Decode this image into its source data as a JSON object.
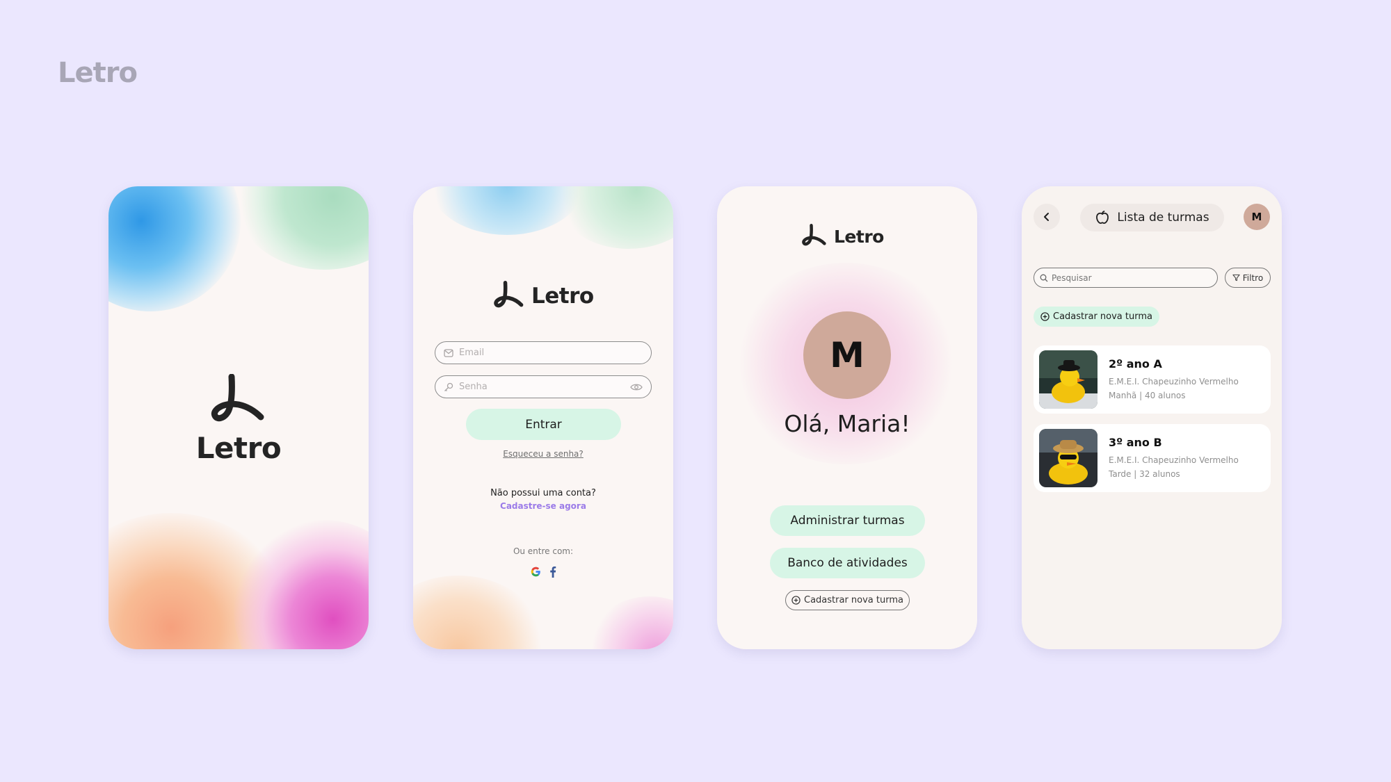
{
  "brand": "Letro",
  "logo_word": "Letro",
  "login": {
    "email_placeholder": "Email",
    "password_placeholder": "Senha",
    "enter_button": "Entrar",
    "forgot_password": "Esqueceu a senha?",
    "no_account": "Não possui uma conta?",
    "signup_link": "Cadastre-se agora",
    "or_enter_with": "Ou entre com:"
  },
  "home": {
    "avatar_initial": "M",
    "greeting": "Olá, Maria!",
    "manage_classes": "Administrar turmas",
    "activities_bank": "Banco de atividades",
    "register_class": "Cadastrar nova turma"
  },
  "classes": {
    "header_title": "Lista de turmas",
    "avatar_initial": "M",
    "search_placeholder": "Pesquisar",
    "filter_label": "Filtro",
    "register_class": "Cadastrar nova turma",
    "items": [
      {
        "title": "2º ano A",
        "school": "E.M.E.I. Chapeuzinho Vermelho",
        "details": "Manhã | 40 alunos"
      },
      {
        "title": "3º ano B",
        "school": "E.M.E.I. Chapeuzinho Vermelho",
        "details": "Tarde | 32 alunos"
      }
    ]
  },
  "colors": {
    "background": "#ebe7fe",
    "mint_button": "#d7f5e6",
    "avatar": "#cfa99a",
    "link_purple": "#9b7be8"
  }
}
